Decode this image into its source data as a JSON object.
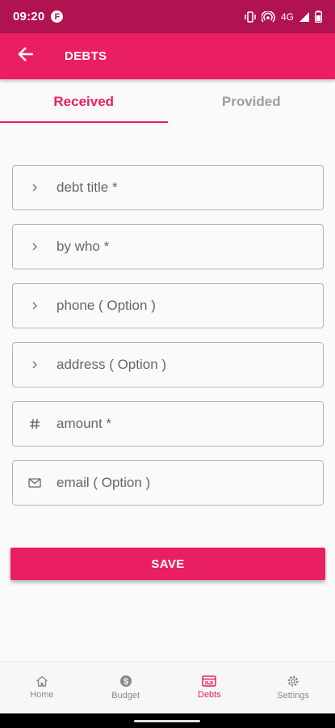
{
  "status_bar": {
    "time": "09:20",
    "notification_letter": "F",
    "network_label": "4G"
  },
  "app_bar": {
    "title": "DEBTS",
    "back_icon": "arrow-back-icon"
  },
  "tabs": [
    {
      "label": "Received",
      "active": true
    },
    {
      "label": "Provided",
      "active": false
    }
  ],
  "form": {
    "fields": [
      {
        "icon": "chevron-right-icon",
        "placeholder": "debt title *"
      },
      {
        "icon": "chevron-right-icon",
        "placeholder": "by who *"
      },
      {
        "icon": "chevron-right-icon",
        "placeholder": "phone ( Option )"
      },
      {
        "icon": "chevron-right-icon",
        "placeholder": "address ( Option )"
      },
      {
        "icon": "hash-icon",
        "placeholder": "amount *"
      },
      {
        "icon": "mail-icon",
        "placeholder": "email ( Option )"
      }
    ],
    "save_label": "SAVE"
  },
  "bottom_nav": [
    {
      "label": "Home",
      "icon": "home-icon",
      "active": false
    },
    {
      "label": "Budget",
      "icon": "dollar-circle-icon",
      "active": false
    },
    {
      "label": "Debts",
      "icon": "debts-icon",
      "active": true
    },
    {
      "label": "Settings",
      "icon": "gear-icon",
      "active": false
    }
  ],
  "colors": {
    "primary": "#e91e63",
    "status_bar": "#b0134f",
    "inactive": "#9e9e9e"
  }
}
